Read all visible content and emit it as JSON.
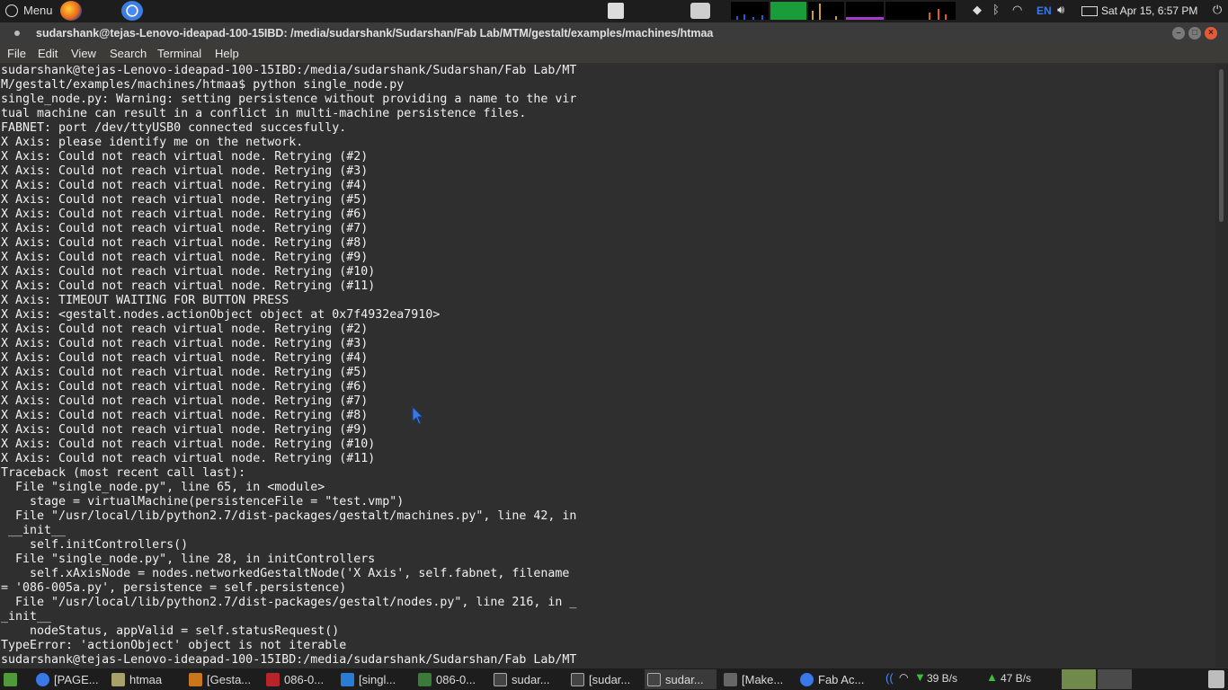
{
  "top_panel": {
    "menu_label": "Menu",
    "lang": "EN",
    "datetime": "Sat Apr 15,  6:57 PM",
    "launchers": [
      "firefox-icon",
      "chromium-icon"
    ],
    "colors": {
      "cpu_graph": "#1a9c3a",
      "net_graph": "#1e5bd8",
      "mem_graph": "#a43cc8"
    }
  },
  "window": {
    "title": "sudarshank@tejas-Lenovo-ideapad-100-15IBD: /media/sudarshank/Sudarshan/Fab Lab/MTM/gestalt/examples/machines/htmaa",
    "minimize": "–",
    "maximize": "□",
    "close": "×"
  },
  "menu": {
    "file": "File",
    "edit": "Edit",
    "view": "View",
    "search": "Search",
    "terminal": "Terminal",
    "help": "Help"
  },
  "terminal_lines": [
    "sudarshank@tejas-Lenovo-ideapad-100-15IBD:/media/sudarshank/Sudarshan/Fab Lab/MT",
    "M/gestalt/examples/machines/htmaa$ python single_node.py",
    "single_node.py: Warning: setting persistence without providing a name to the vir",
    "tual machine can result in a conflict in multi-machine persistence files.",
    "FABNET: port /dev/ttyUSB0 connected succesfully.",
    "X Axis: please identify me on the network.",
    "X Axis: Could not reach virtual node. Retrying (#2)",
    "X Axis: Could not reach virtual node. Retrying (#3)",
    "X Axis: Could not reach virtual node. Retrying (#4)",
    "X Axis: Could not reach virtual node. Retrying (#5)",
    "X Axis: Could not reach virtual node. Retrying (#6)",
    "X Axis: Could not reach virtual node. Retrying (#7)",
    "X Axis: Could not reach virtual node. Retrying (#8)",
    "X Axis: Could not reach virtual node. Retrying (#9)",
    "X Axis: Could not reach virtual node. Retrying (#10)",
    "X Axis: Could not reach virtual node. Retrying (#11)",
    "X Axis: TIMEOUT WAITING FOR BUTTON PRESS",
    "X Axis: <gestalt.nodes.actionObject object at 0x7f4932ea7910>",
    "X Axis: Could not reach virtual node. Retrying (#2)",
    "X Axis: Could not reach virtual node. Retrying (#3)",
    "X Axis: Could not reach virtual node. Retrying (#4)",
    "X Axis: Could not reach virtual node. Retrying (#5)",
    "X Axis: Could not reach virtual node. Retrying (#6)",
    "X Axis: Could not reach virtual node. Retrying (#7)",
    "X Axis: Could not reach virtual node. Retrying (#8)",
    "X Axis: Could not reach virtual node. Retrying (#9)",
    "X Axis: Could not reach virtual node. Retrying (#10)",
    "X Axis: Could not reach virtual node. Retrying (#11)",
    "Traceback (most recent call last):",
    "  File \"single_node.py\", line 65, in <module>",
    "    stage = virtualMachine(persistenceFile = \"test.vmp\")",
    "  File \"/usr/local/lib/python2.7/dist-packages/gestalt/machines.py\", line 42, in",
    " __init__",
    "    self.initControllers()",
    "  File \"single_node.py\", line 28, in initControllers",
    "    self.xAxisNode = nodes.networkedGestaltNode('X Axis', self.fabnet, filename",
    "= '086-005a.py', persistence = self.persistence)",
    "  File \"/usr/local/lib/python2.7/dist-packages/gestalt/nodes.py\", line 216, in _",
    "_init__",
    "    nodeStatus, appValid = self.statusRequest()",
    "TypeError: 'actionObject' object is not iterable",
    "sudarshank@tejas-Lenovo-ideapad-100-15IBD:/media/sudarshank/Sudarshan/Fab Lab/MT"
  ],
  "taskbar": {
    "tasks": [
      {
        "label": "[PAGE...",
        "icon": "chromium-icon",
        "color": "#3b78e7"
      },
      {
        "label": "htmaa",
        "icon": "folder-icon",
        "color": "#a8a16b"
      },
      {
        "label": "[Gesta...",
        "icon": "editor-icon",
        "color": "#c9771a"
      },
      {
        "label": "086-0...",
        "icon": "pdf-icon",
        "color": "#b8242a"
      },
      {
        "label": "[singl...",
        "icon": "vscode-icon",
        "color": "#2a7bd3"
      },
      {
        "label": "086-0...",
        "icon": "image-icon",
        "color": "#3a7b3a"
      },
      {
        "label": "sudar...",
        "icon": "terminal-icon",
        "color": "#444444"
      },
      {
        "label": "[sudar...",
        "icon": "terminal-icon",
        "color": "#444444"
      },
      {
        "label": "sudar...",
        "icon": "terminal-icon",
        "color": "#444444",
        "active": true
      },
      {
        "label": "[Make...",
        "icon": "text-editor-icon",
        "color": "#666666"
      },
      {
        "label": "Fab Ac...",
        "icon": "chromium-icon",
        "color": "#3b78e7"
      }
    ],
    "net_down": "39 B/s",
    "net_up": "47 B/s"
  }
}
